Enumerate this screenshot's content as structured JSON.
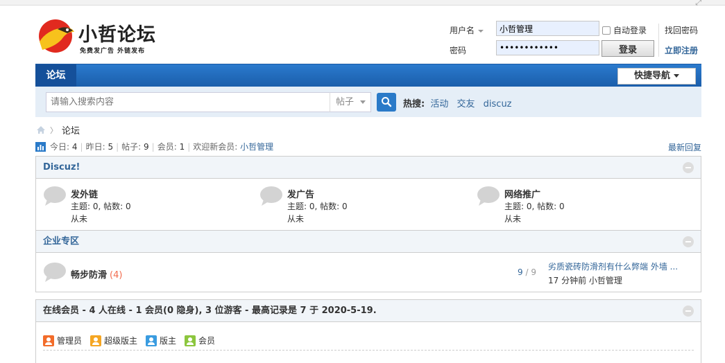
{
  "logo": {
    "title": "小哲论坛",
    "subtitle": "免费发广告 外链发布"
  },
  "login": {
    "username_label": "用户名",
    "username_value": "小哲管理",
    "password_label": "密码",
    "password_value": "••••••••••••",
    "autologin_label": "自动登录",
    "find_password": "找回密码",
    "login_button": "登录",
    "register": "立即注册"
  },
  "nav": {
    "tab": "论坛",
    "quicknav": "快捷导航"
  },
  "search": {
    "placeholder": "请输入搜索内容",
    "type": "帖子",
    "hot_label": "热搜:",
    "hot_keywords": [
      "活动",
      "交友",
      "discuz"
    ]
  },
  "breadcrumb": {
    "current": "论坛"
  },
  "stats": {
    "today_label": "今日:",
    "today": "4",
    "yesterday_label": "昨日:",
    "yesterday": "5",
    "posts_label": "帖子:",
    "posts": "9",
    "members_label": "会员:",
    "members": "1",
    "welcome_label": "欢迎新会员:",
    "newest_member": "小哲管理",
    "latest_replies": "最新回复"
  },
  "category1": {
    "title": "Discuz!",
    "forums": [
      {
        "name": "发外链",
        "meta": "主题: 0, 帖数: 0",
        "last": "从未"
      },
      {
        "name": "发广告",
        "meta": "主题: 0, 帖数: 0",
        "last": "从未"
      },
      {
        "name": "网络推广",
        "meta": "主题: 0, 帖数: 0",
        "last": "从未"
      }
    ]
  },
  "category2": {
    "title": "企业专区",
    "forum": {
      "name": "畅步防滑",
      "count": "(4)",
      "threads": "9",
      "sep": "/",
      "posts": "9",
      "last_title": "劣质瓷砖防滑剂有什么弊端 外墙 ...",
      "last_by": "17 分钟前 小哲管理"
    }
  },
  "online": {
    "title": "在线会员 - 4 人在线 - 1 会员(0 隐身), 3 位游客 - 最高记录是 7 于 2020-5-19.",
    "legend": [
      {
        "label": "管理员",
        "color": "#f26c2a"
      },
      {
        "label": "超级版主",
        "color": "#f5a623"
      },
      {
        "label": "版主",
        "color": "#3a9ce0"
      },
      {
        "label": "会员",
        "color": "#8cc63e"
      }
    ]
  }
}
